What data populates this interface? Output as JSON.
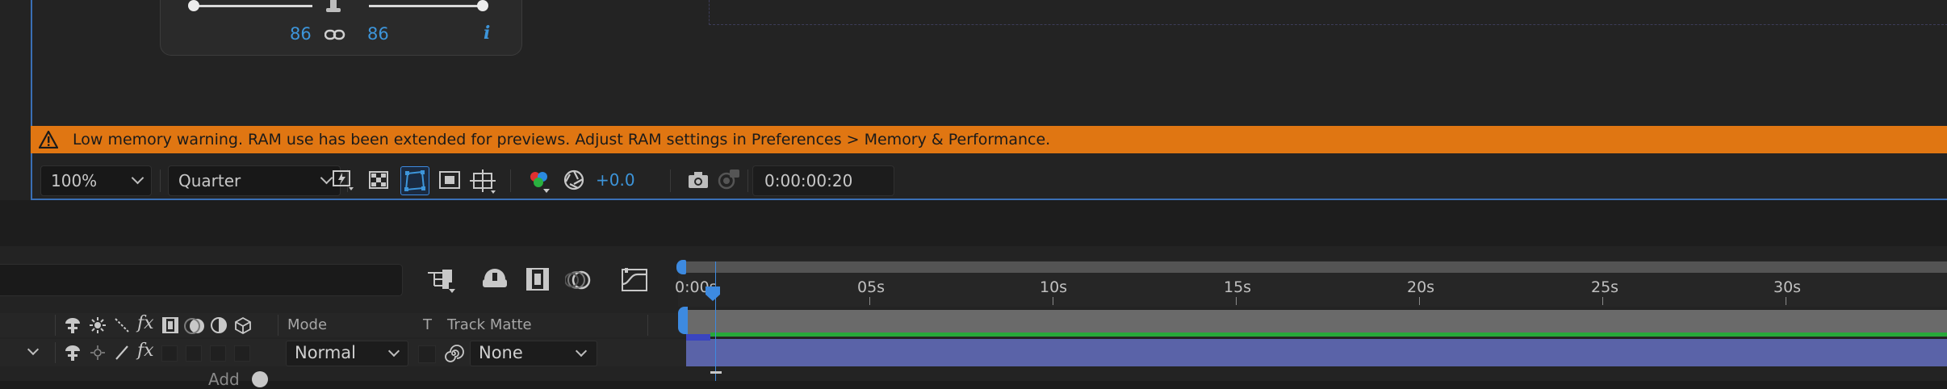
{
  "viewer": {
    "color_panel": {
      "left_value": "86",
      "right_value": "86",
      "info_label": "i"
    },
    "warning": {
      "text": "Low memory warning. RAM use has been extended for previews. Adjust RAM settings in Preferences > Memory & Performance."
    },
    "toolbar": {
      "zoom_value": "100%",
      "resolution_value": "Quarter",
      "exposure_value": "+0.0",
      "timecode": "0:00:00:20"
    }
  },
  "timeline": {
    "ruler_labels": [
      "0:00s",
      "05s",
      "10s",
      "15s",
      "20s",
      "25s",
      "30s"
    ],
    "columns": {
      "mode": "Mode",
      "t": "T",
      "track_matte": "Track Matte"
    },
    "layer": {
      "mode_value": "Normal",
      "matte_value": "None",
      "add_label": "Add"
    }
  },
  "colors": {
    "accent": "#3d8ae0",
    "warning": "#e07612",
    "layer_bar": "#5a63a8",
    "work_area": "#6a6a6a",
    "green": "#27a83a"
  },
  "icons": [
    "warning-icon",
    "fast-preview-icon",
    "transparency-grid-icon",
    "mask-path-icon",
    "region-of-interest-icon",
    "guides-icon",
    "channel-icon",
    "exposure-icon",
    "snapshot-icon",
    "show-snapshot-icon",
    "link-icon",
    "lock-icon",
    "comp-flowchart-icon",
    "draft-3d-icon",
    "frame-blending-icon",
    "motion-blur-icon",
    "graph-editor-icon",
    "solo-icon",
    "shy-icon",
    "collapse-icon",
    "fx-icon",
    "adjustment-icon",
    "3d-layer-icon",
    "spiral-icon"
  ]
}
